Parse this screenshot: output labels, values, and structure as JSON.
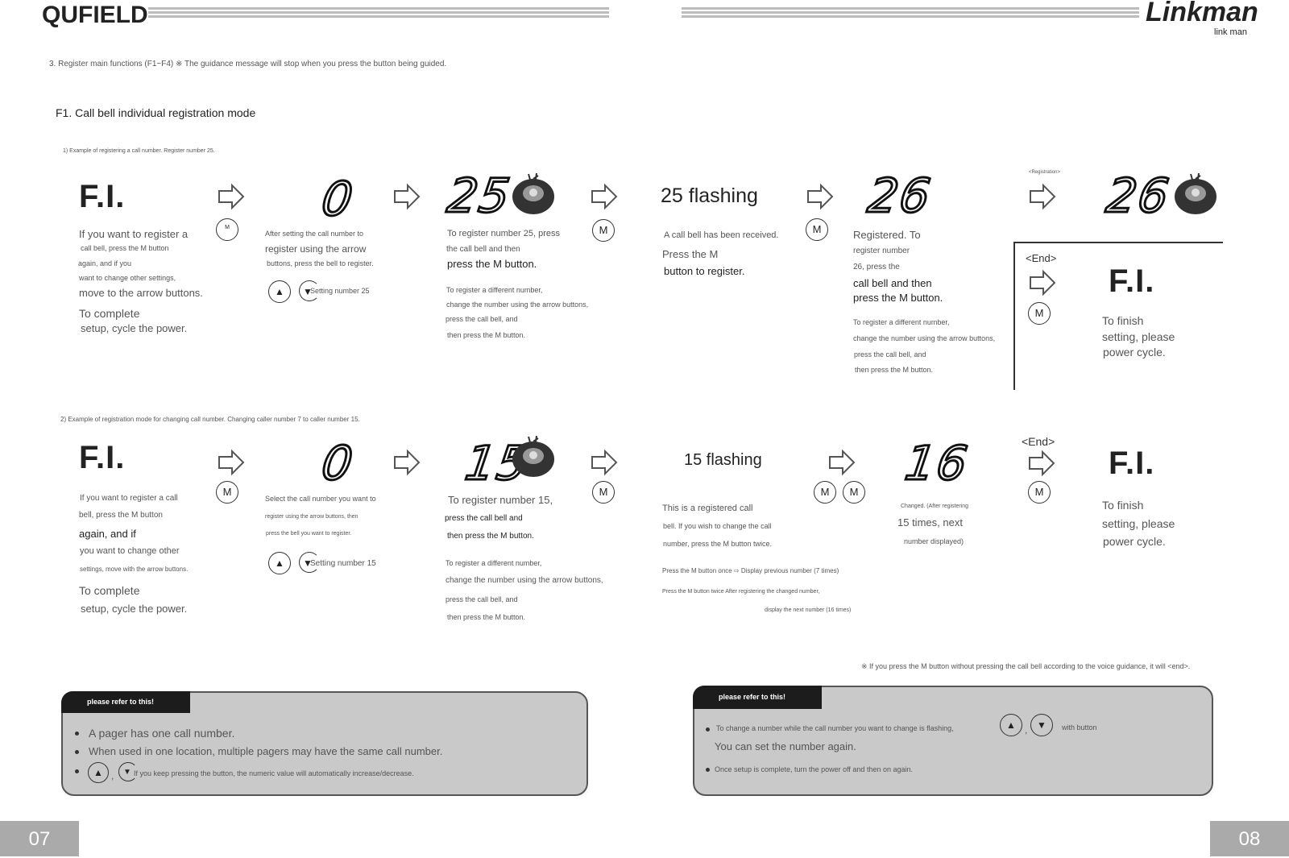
{
  "header": {
    "left_brand": "QUFIELD",
    "right_brand": "Linkman",
    "right_sub": "link man"
  },
  "intro": "3. Register main functions (F1~F4) ※ The guidance message will stop when you press the button being guided.",
  "section_title": "F1. Call bell individual registration mode",
  "ex1": {
    "caption": "1) Example of registering a call number. Register number 25.",
    "step1": {
      "display": "F.I.",
      "l1": "If you want to register a",
      "l2": "call bell, press the M button",
      "l3": "again, and if you",
      "l4": "want to change other settings,",
      "l5": "move to the arrow buttons.",
      "l6": "To complete",
      "l7": "setup, cycle the power."
    },
    "step2": {
      "display": "0",
      "l1": "After setting the call number to",
      "l2": "register using the arrow",
      "l3": "buttons, press the bell to register.",
      "setting": "Setting number 25"
    },
    "step3": {
      "display": "25",
      "l1": "To register number 25, press",
      "l2": "the call bell and then",
      "l3": "press the M button.",
      "l4": "To register a different number,",
      "l5": "change the number using the arrow buttons,",
      "l6": "press the call bell, and",
      "l7": "then press the M button."
    },
    "step4": {
      "display": "25 flashing",
      "l1": "A call bell has been received.",
      "l2": "Press the M",
      "l3": "button to register."
    },
    "step5": {
      "display": "26",
      "l1": "Registered. To",
      "l2": "register number",
      "l3": "26, press the",
      "l4": "call bell and then",
      "l5": "press the M button.",
      "l6": "To register a different number,",
      "l7": "change the number using the arrow buttons,",
      "l8": "press the call bell, and",
      "l9": "then press the M button."
    },
    "registration_label": "<Registration>",
    "step6": {
      "display": "26"
    },
    "end_label": "<End>",
    "step7": {
      "display": "F.I.",
      "l1": "To finish",
      "l2": "setting, please",
      "l3": "power cycle."
    }
  },
  "ex2": {
    "caption": "2) Example of registration mode for changing call number. Changing caller number 7 to caller number 15.",
    "step1": {
      "display": "F.I.",
      "l1": "If you want to register a call",
      "l2": "bell, press the M button",
      "l3": "again, and if",
      "l4": "you want to change other",
      "l5": "settings, move with the arrow buttons.",
      "l6": "To complete",
      "l7": "setup, cycle the power."
    },
    "step2": {
      "display": "0",
      "l1": "Select the call number you want to",
      "l2": "register using the arrow buttons, then",
      "l3": "press the bell you want to register.",
      "setting": "Setting number 15"
    },
    "step3": {
      "display": "15",
      "l1": "To register number 15,",
      "l2": "press the call bell and",
      "l3": "then press the M button.",
      "l4": "To register a different number,",
      "l5": "change the number using the arrow buttons,",
      "l6": "press the call bell, and",
      "l7": "then press the M button."
    },
    "step4": {
      "display": "15 flashing",
      "l1": "This is a registered call",
      "l2": "bell. If you wish to change the call",
      "l3": "number, press the M button twice.",
      "l4": "Press the M button once ⇨ Display previous number (7 times)",
      "l5": "Press the M button twice After registering the changed number,",
      "l6": "display the next number (16 times)"
    },
    "step5": {
      "display": "16",
      "l1": "Changed. (After registering",
      "l2": "15 times, next",
      "l3": "number displayed)"
    },
    "end_label": "<End>",
    "step6": {
      "display": "F.I.",
      "l1": "To finish",
      "l2": "setting, please",
      "l3": "power cycle."
    }
  },
  "note_right": "※ If you press the M button without pressing the call bell according to the voice guidance, it will <end>.",
  "box_left": {
    "head": "please refer to this!",
    "b1": "A pager has one call number.",
    "b2": "When used in one location, multiple pagers may have the same call number.",
    "b3": "If you keep pressing the button, the numeric value will automatically increase/decrease."
  },
  "box_right": {
    "head": "please refer to this!",
    "b1a": "To change a number while the call number you want to change is flashing,",
    "b1b": "with button",
    "b1c": "You can set the number again.",
    "b2": "Once setup is complete, turn the power off and then on again."
  },
  "buttons": {
    "m": "M",
    "up": "▲",
    "down": "▼",
    "sep": ","
  },
  "pages": {
    "left": "07",
    "right": "08"
  }
}
